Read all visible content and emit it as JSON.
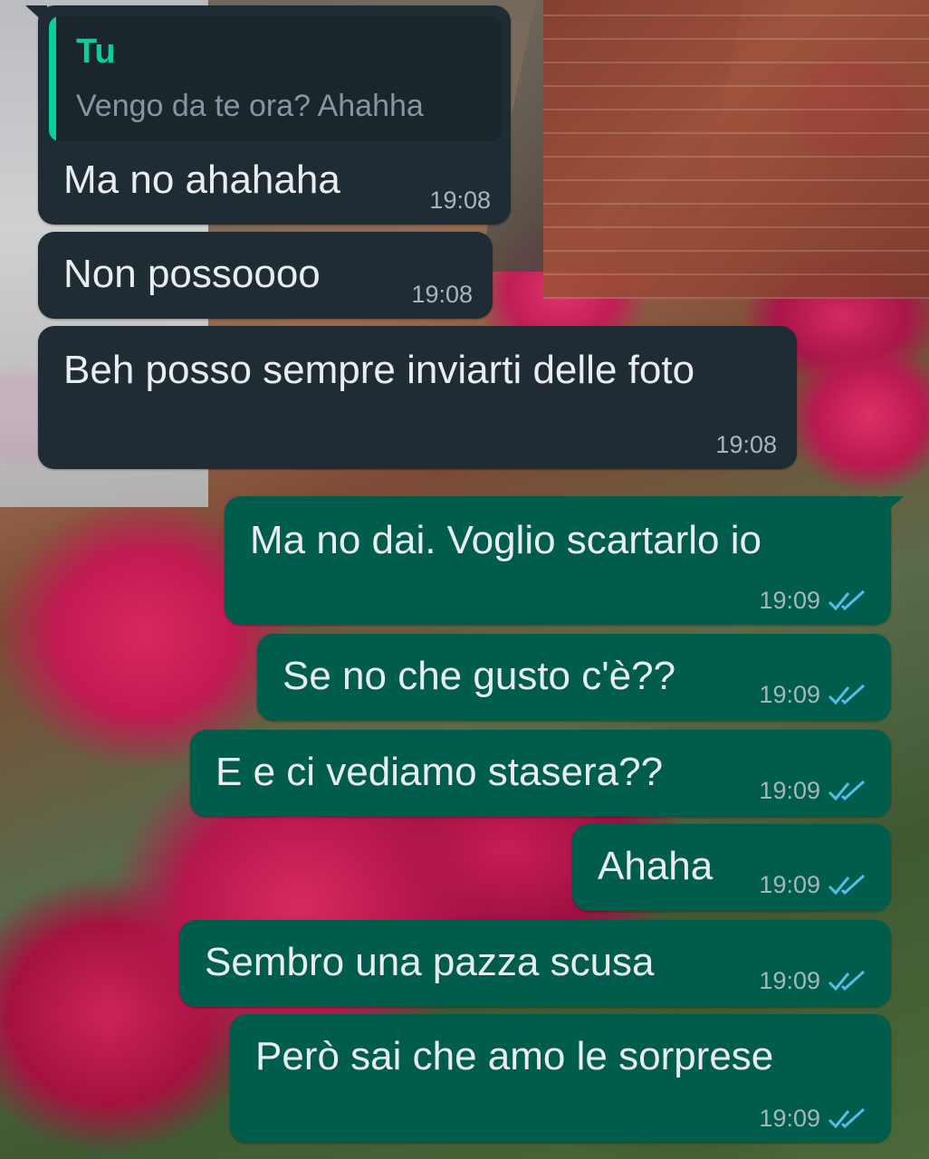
{
  "reply_quote": {
    "author": "Tu",
    "text": "Vengo da te ora? Ahahha"
  },
  "messages": [
    {
      "direction": "incoming",
      "text": "Ma no ahahaha",
      "time": "19:08"
    },
    {
      "direction": "incoming",
      "text": "Non possoooo",
      "time": "19:08"
    },
    {
      "direction": "incoming",
      "text": "Beh posso sempre inviarti delle foto",
      "time": "19:08"
    },
    {
      "direction": "outgoing",
      "text": "Ma no dai. Voglio scartarlo io",
      "time": "19:09",
      "status": "read"
    },
    {
      "direction": "outgoing",
      "text": "Se no che gusto c'è??",
      "time": "19:09",
      "status": "read"
    },
    {
      "direction": "outgoing",
      "text": "E e ci vediamo stasera??",
      "time": "19:09",
      "status": "read"
    },
    {
      "direction": "outgoing",
      "text": "Ahaha",
      "time": "19:09",
      "status": "read"
    },
    {
      "direction": "outgoing",
      "text": "Sembro una pazza scusa",
      "time": "19:09",
      "status": "read"
    },
    {
      "direction": "outgoing",
      "text": "Però sai che amo le sorprese",
      "time": "19:09",
      "status": "read"
    }
  ],
  "colors": {
    "incoming_bubble": "#1f2c34",
    "outgoing_bubble": "#005c4b",
    "quote_accent": "#06cf9c",
    "read_ticks": "#53bdeb"
  },
  "icons": {
    "read_receipt": "double-check-icon"
  }
}
